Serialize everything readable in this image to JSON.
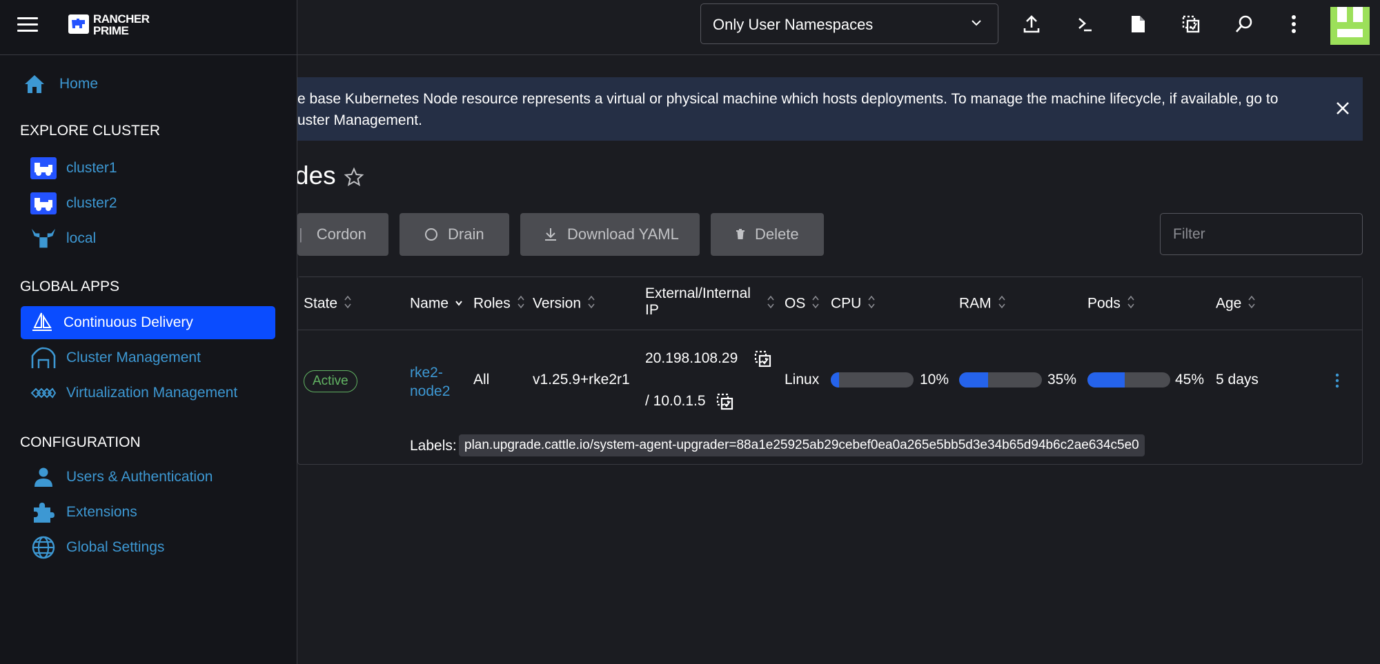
{
  "header": {
    "namespace_filter": "Only User Namespaces",
    "icons": [
      "import-yaml-icon",
      "kubectl-shell-icon",
      "kubeconfig-file-icon",
      "copy-kubeconfig-icon",
      "search-icon",
      "more-vert-icon"
    ]
  },
  "banner": {
    "text": "e base Kubernetes Node resource represents a virtual or physical machine which hosts deployments. To manage the machine lifecycle, if available, go to uster Management."
  },
  "page": {
    "title": "des"
  },
  "toolbar": {
    "cordon": "Cordon",
    "drain": "Drain",
    "download_yaml": "Download YAML",
    "delete": "Delete",
    "filter_placeholder": "Filter"
  },
  "table": {
    "headers": {
      "state": "State",
      "name": "Name",
      "roles": "Roles",
      "version": "Version",
      "ip": "External/Internal IP",
      "os": "OS",
      "cpu": "CPU",
      "ram": "RAM",
      "pods": "Pods",
      "age": "Age"
    },
    "row": {
      "state": "Active",
      "name": "rke2-node2",
      "roles": "All",
      "version": "v1.25.9+rke2r1",
      "external_ip": "20.198.108.29",
      "internal_ip": "/ 10.0.1.5",
      "os": "Linux",
      "cpu_pct": "10%",
      "cpu_value": 10,
      "ram_pct": "35%",
      "ram_value": 35,
      "pods_pct": "45%",
      "pods_value": 45,
      "age": "5 days",
      "labels_key": "Labels:",
      "labels_value": "plan.upgrade.cattle.io/system-agent-upgrader=88a1e25925ab29cebef0ea0a265e5bb5d3e34b65d94b6c2ae634c5e0"
    }
  },
  "nav": {
    "brand": "RANCHER PRIME",
    "brand_line1": "RANCHER",
    "brand_line2": "PRIME",
    "home": "Home",
    "explore_cluster_heading": "EXPLORE CLUSTER",
    "clusters": [
      "cluster1",
      "cluster2",
      "local"
    ],
    "global_apps_heading": "GLOBAL APPS",
    "global_apps": [
      "Continuous Delivery",
      "Cluster Management",
      "Virtualization Management"
    ],
    "configuration_heading": "CONFIGURATION",
    "configuration": [
      "Users & Authentication",
      "Extensions",
      "Global Settings"
    ]
  },
  "colors": {
    "background": "#1b1c21",
    "nav_background": "#14151a",
    "link": "#3d98d3",
    "active_nav": "#0a4cff",
    "banner": "#252f45",
    "progress_fill": "#2563eb",
    "active_badge": "#62b463",
    "avatar": "#9ce05a"
  }
}
